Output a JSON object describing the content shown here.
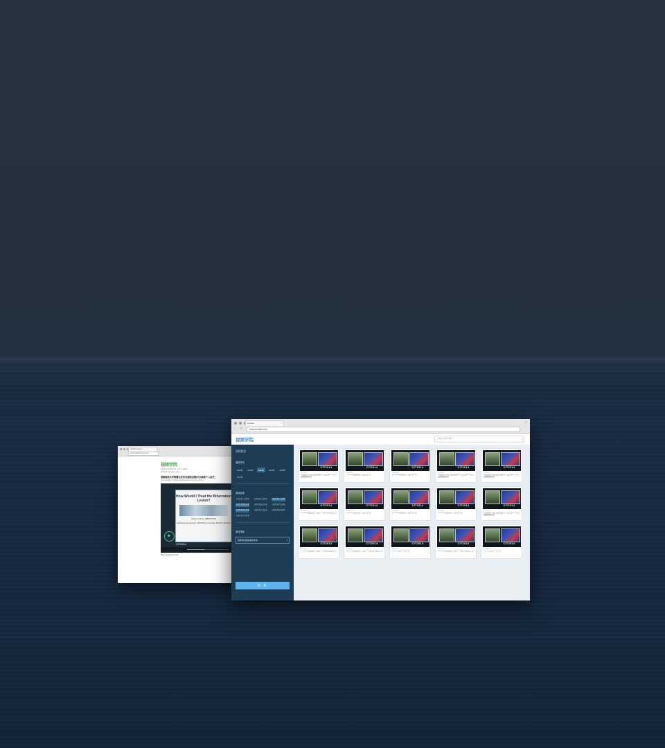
{
  "back_window": {
    "tab_title": "Untitled Layout",
    "url": "www.crossthepygmy.com",
    "logo": "视频学院",
    "subtitle_lines": [
      "发布时间: 2014年6月 主讲: 专业医师",
      "所属专题: 冠心病介入治疗"
    ],
    "video_title": "首都医科大学附属北京安贞医院(冠脉分叉病变介入治疗)",
    "meta": "Beijing Anzhen Hospital, Capital Medical University, Beijing",
    "slide_title": "How Would I Treat the Bifurcation Lesion?",
    "slide_presenter": "Robert A. Byrne, MB BCh PhD",
    "slide_affiliation": "Deutsches Herzzentrum, Technische Universität, Munich, Germany",
    "player_watermark": "CIT2014",
    "player_progress": 0.42,
    "footer": "Share   Embed   Go Fast"
  },
  "front_window": {
    "tab_title": "Encalls",
    "url": "www.encalls.com",
    "logo": "视频学院",
    "search_placeholder": "请输入关键字搜索",
    "sidebar": {
      "title": "视频检索",
      "sections": [
        {
          "label": "选择时间",
          "chips": [
            {
              "label": "2012年",
              "selected": false
            },
            {
              "label": "2013年",
              "selected": false
            },
            {
              "label": "2014年",
              "selected": true
            },
            {
              "label": "2015年",
              "selected": false
            },
            {
              "label": "2016年",
              "selected": false
            },
            {
              "label": "2017年",
              "selected": false
            }
          ]
        }
      ],
      "venue_label": "选择会场",
      "venues": [
        {
          "label": "主会场 第一会议室",
          "selected": false
        },
        {
          "label": "分会场 第二会议室",
          "selected": false
        },
        {
          "label": "分会场 第三会议室",
          "selected": true
        },
        {
          "label": "主会场 第四会议室",
          "selected": true
        },
        {
          "label": "分会场 第五会议室",
          "selected": false
        },
        {
          "label": "分会场 第六会议室",
          "selected": false
        },
        {
          "label": "主会场 第七会议室",
          "selected": true
        },
        {
          "label": "分会场 第八会议室",
          "selected": false
        },
        {
          "label": "分会场 第九会议室",
          "selected": false
        },
        {
          "label": "主会场 第十会议室",
          "selected": false
        }
      ],
      "topic_label": "选择专题",
      "topic_value": "选择相关疾病/相关术者",
      "search_button": "检 索"
    },
    "videos": [
      {
        "date": "2014年6月",
        "title": "中国胸痛中心及主要影像融合——第二届GI·TOP血运重建高峰论坛"
      },
      {
        "date": "2014年6月",
        "title": "CHC2014冠脉病变介入治疗第一场"
      },
      {
        "date": "2014年6月",
        "title": "CHC2014冠脉病变介入治疗第一场"
      },
      {
        "date": "2014年6月",
        "title": "中国胸痛中心及主要影像融合——第二届GI·TOP血运重建高峰论坛"
      },
      {
        "date": "2014年6月",
        "title": "中国胸痛中心及主要影像融合——第二届GI·TOP血运重建高峰论坛"
      },
      {
        "date": "2014年6月",
        "title": "CHC2014冠脉病变介入治疗——结构性心脏病二场"
      },
      {
        "date": "2014年6月",
        "title": "CHC2014冠脉病变介入治疗第一场"
      },
      {
        "date": "2014年6月",
        "title": "CHC2014冠脉病变介入治疗第一场"
      },
      {
        "date": "2014年6月",
        "title": "CHC2014冠脉病变介入治疗第一场"
      },
      {
        "date": "2014年6月",
        "title": "中国胸痛中心及主要影像融合——第二届GI·TOP血运重建高峰论坛"
      },
      {
        "date": "2014年6月",
        "title": "CHC2014冠脉病变介入治疗——结构性心脏病二场"
      },
      {
        "date": "2014年6月",
        "title": "CHC2014冠脉病变介入治疗——结构性心脏病二场"
      },
      {
        "date": "2014年6月",
        "title": "CTO介入治疗——第一场"
      },
      {
        "date": "2014年6月",
        "title": "CHC2014冠脉病变介入治疗——结构性心脏病二场"
      },
      {
        "date": "2014年6月",
        "title": "CTO介入治疗——第一场"
      }
    ],
    "thumb_watermark": "CIT2014"
  },
  "colors": {
    "sidebar_bg": "#1f3c55",
    "accent": "#5fb3e8",
    "brand_logo": "#4a8fc7",
    "back_logo": "#3ea44a"
  }
}
